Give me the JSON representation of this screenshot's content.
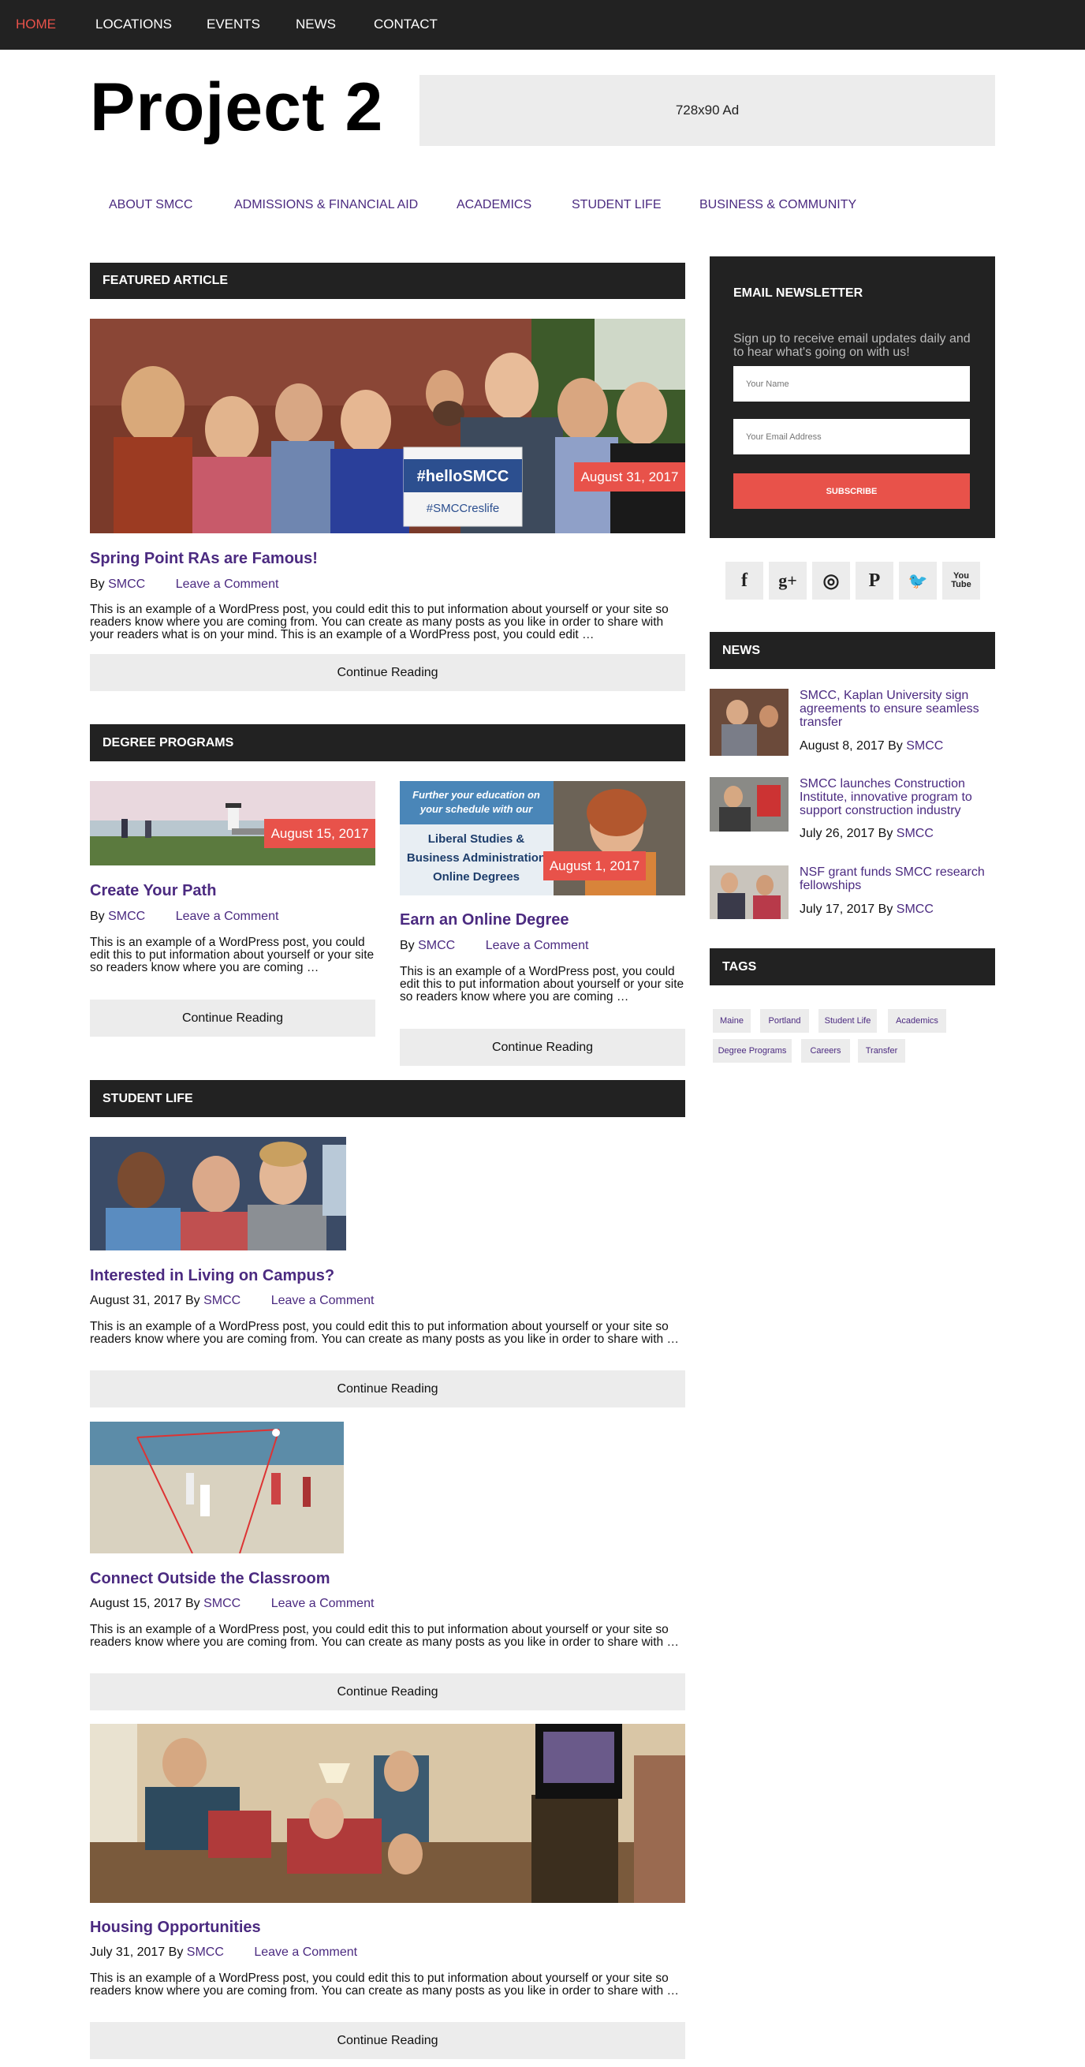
{
  "topnav": {
    "items": [
      "HOME",
      "LOCATIONS",
      "EVENTS",
      "NEWS",
      "CONTACT"
    ]
  },
  "header": {
    "site_title": "Project 2",
    "ad_label": "728x90 Ad"
  },
  "subnav": {
    "items": [
      "ABOUT SMCC",
      "ADMISSIONS & FINANCIAL AID",
      "ACADEMICS",
      "STUDENT LIFE",
      "BUSINESS & COMMUNITY"
    ]
  },
  "featured": {
    "heading": "FEATURED ARTICLE",
    "date": "August 31, 2017",
    "sign_line1": "#helloSMCC",
    "sign_line2": "#SMCCreslife",
    "title": "Spring Point RAs are Famous!",
    "by": "By",
    "author": "SMCC",
    "comment": "Leave a Comment",
    "excerpt": "This is an example of a WordPress post, you could edit this to put information about yourself or your site so readers know where you are coming from. You can create as many posts as you like in order to share with your readers what is on your mind. This is an example of a WordPress post, you could edit …",
    "button": "Continue Reading"
  },
  "degree": {
    "heading": "DEGREE PROGRAMS",
    "left": {
      "date": "August 15, 2017",
      "title": "Create Your Path",
      "by": "By",
      "author": "SMCC",
      "comment": "Leave a Comment",
      "excerpt": "This is an example of a WordPress post, you could edit this to put information about yourself or your site so readers know where you are coming …",
      "button": "Continue Reading"
    },
    "right": {
      "promo_line1": "Further your education on",
      "promo_line2": "your schedule with our",
      "promo_line3": "Liberal Studies &",
      "promo_line4": "Business Administration",
      "promo_line5": "Online Degrees",
      "date": "August 1, 2017",
      "title": "Earn an Online Degree",
      "by": "By",
      "author": "SMCC",
      "comment": "Leave a Comment",
      "excerpt": "This is an example of a WordPress post, you could edit this to put information about yourself or your site so readers know where you are coming …",
      "button": "Continue Reading"
    }
  },
  "student_life": {
    "heading": "STUDENT LIFE",
    "posts": [
      {
        "title": "Interested in Living on Campus?",
        "date": "August 31, 2017",
        "by": "By",
        "author": "SMCC",
        "comment": "Leave a Comment",
        "excerpt": "This is an example of a WordPress post, you could edit this to put information about yourself or your site so readers know where you are coming from. You can create as many posts as you like in order to share with …",
        "button": "Continue Reading"
      },
      {
        "title": "Connect Outside the Classroom",
        "date": "August 15, 2017",
        "by": "By",
        "author": "SMCC",
        "comment": "Leave a Comment",
        "excerpt": "This is an example of a WordPress post, you could edit this to put information about yourself or your site so readers know where you are coming from. You can create as many posts as you like in order to share with …",
        "button": "Continue Reading"
      },
      {
        "title": "Housing Opportunities",
        "date": "July 31, 2017",
        "by": "By",
        "author": "SMCC",
        "comment": "Leave a Comment",
        "excerpt": "This is an example of a WordPress post, you could edit this to put information about yourself or your site so readers know where you are coming from. You can create as many posts as you like in order to share with …",
        "button": "Continue Reading"
      }
    ]
  },
  "newsletter": {
    "heading": "EMAIL NEWSLETTER",
    "text": "Sign up to receive email updates daily and to hear what's going on with us!",
    "name_placeholder": "Your Name",
    "email_placeholder": "Your Email Address",
    "button": "SUBSCRIBE"
  },
  "social": {
    "icons": [
      "facebook-icon",
      "google-plus-icon",
      "instagram-icon",
      "pinterest-icon",
      "twitter-icon",
      "youtube-icon"
    ],
    "glyphs": [
      "f",
      "g+",
      "◎",
      "P",
      "🐦",
      "You Tube"
    ]
  },
  "news": {
    "heading": "NEWS",
    "items": [
      {
        "title": "SMCC, Kaplan University sign agreements to ensure seamless transfer",
        "date": "August 8, 2017",
        "by": "By",
        "author": "SMCC"
      },
      {
        "title": "SMCC launches Construction Institute, innovative program to support construction industry",
        "date": "July 26, 2017",
        "by": "By",
        "author": "SMCC"
      },
      {
        "title": "NSF grant funds SMCC research fellowships",
        "date": "July 17, 2017",
        "by": "By",
        "author": "SMCC"
      }
    ]
  },
  "tags": {
    "heading": "TAGS",
    "items": [
      "Maine",
      "Portland",
      "Student Life",
      "Academics",
      "Degree Programs",
      "Careers",
      "Transfer"
    ]
  },
  "colors": {
    "dark_bar": "#222222",
    "accent_red": "#e8524a",
    "link_purple": "#4b2a80",
    "light_gray": "#ececec"
  }
}
